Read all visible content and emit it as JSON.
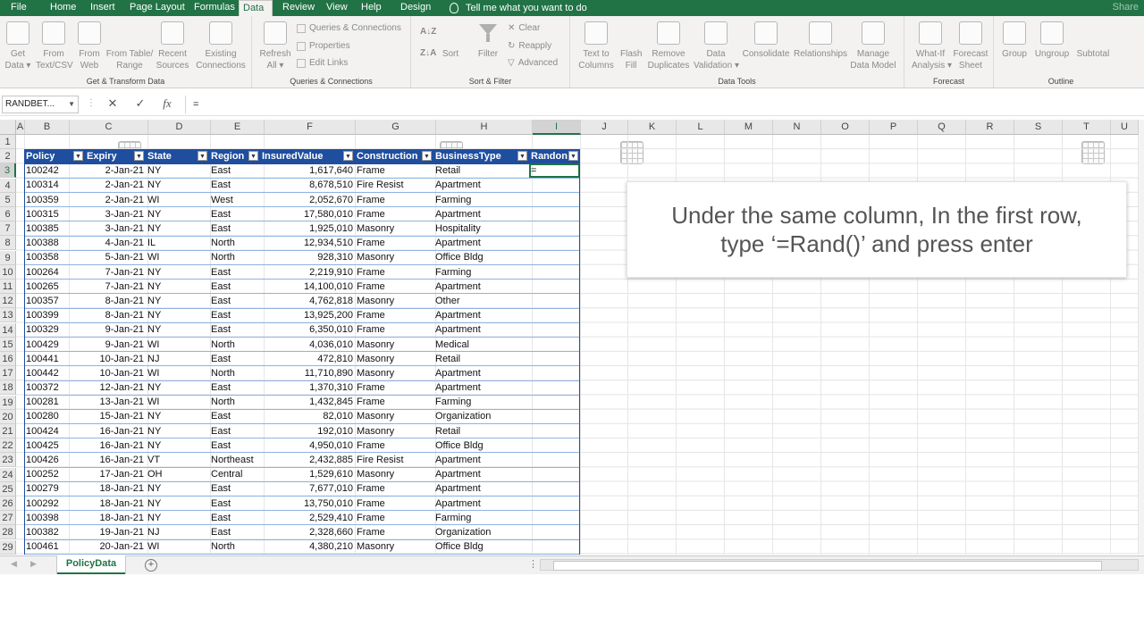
{
  "tabs": [
    "File",
    "Home",
    "Insert",
    "Page Layout",
    "Formulas",
    "Data",
    "Review",
    "View",
    "Help",
    "Design"
  ],
  "active_tab": "Data",
  "tell_me": "Tell me what you want to do",
  "share": "Share",
  "ribbon": {
    "get_transform": {
      "label": "Get & Transform Data",
      "buttons": [
        "Get\nData ▾",
        "From\nText/CSV",
        "From\nWeb",
        "From Table/\nRange",
        "Recent\nSources",
        "Existing\nConnections"
      ]
    },
    "queries": {
      "label": "Queries & Connections",
      "refresh": "Refresh\nAll ▾",
      "items": [
        "Queries & Connections",
        "Properties",
        "Edit Links"
      ]
    },
    "sort_filter": {
      "label": "Sort & Filter",
      "sort": "Sort",
      "filter": "Filter",
      "items": [
        "Clear",
        "Reapply",
        "Advanced"
      ]
    },
    "data_tools": {
      "label": "Data Tools",
      "buttons": [
        "Text to\nColumns",
        "Flash\nFill",
        "Remove\nDuplicates",
        "Data\nValidation ▾",
        "Consolidate",
        "Relationships",
        "Manage\nData Model"
      ]
    },
    "forecast": {
      "label": "Forecast",
      "buttons": [
        "What-If\nAnalysis ▾",
        "Forecast\nSheet"
      ]
    },
    "outline": {
      "label": "Outline",
      "buttons": [
        "Group",
        "Ungroup",
        "Subtotal"
      ]
    }
  },
  "formula_bar": {
    "name_box": "RANDBET...",
    "formula": "="
  },
  "columns": [
    "A",
    "B",
    "C",
    "D",
    "E",
    "F",
    "G",
    "H",
    "I",
    "J",
    "K",
    "L",
    "M",
    "N",
    "O",
    "P",
    "Q",
    "R",
    "S",
    "T",
    "U"
  ],
  "rows": [
    "1",
    "2",
    "3",
    "4",
    "5",
    "6",
    "7",
    "8",
    "9",
    "10",
    "11",
    "12",
    "13",
    "14",
    "15",
    "16",
    "17",
    "18",
    "19",
    "20",
    "21",
    "22",
    "23",
    "24",
    "25",
    "26",
    "27",
    "28",
    "29"
  ],
  "table": {
    "headers": [
      "Policy",
      "Expiry",
      "State",
      "Region",
      "InsuredValue",
      "Construction",
      "BusinessType",
      "Randon"
    ],
    "rows": [
      [
        "100242",
        "2-Jan-21",
        "NY",
        "East",
        "1,617,640",
        "Frame",
        "Retail",
        "="
      ],
      [
        "100314",
        "2-Jan-21",
        "NY",
        "East",
        "8,678,510",
        "Fire Resist",
        "Apartment",
        ""
      ],
      [
        "100359",
        "2-Jan-21",
        "WI",
        "West",
        "2,052,670",
        "Frame",
        "Farming",
        ""
      ],
      [
        "100315",
        "3-Jan-21",
        "NY",
        "East",
        "17,580,010",
        "Frame",
        "Apartment",
        ""
      ],
      [
        "100385",
        "3-Jan-21",
        "NY",
        "East",
        "1,925,010",
        "Masonry",
        "Hospitality",
        ""
      ],
      [
        "100388",
        "4-Jan-21",
        "IL",
        "North",
        "12,934,510",
        "Frame",
        "Apartment",
        ""
      ],
      [
        "100358",
        "5-Jan-21",
        "WI",
        "North",
        "928,310",
        "Masonry",
        "Office Bldg",
        ""
      ],
      [
        "100264",
        "7-Jan-21",
        "NY",
        "East",
        "2,219,910",
        "Frame",
        "Farming",
        ""
      ],
      [
        "100265",
        "7-Jan-21",
        "NY",
        "East",
        "14,100,010",
        "Frame",
        "Apartment",
        ""
      ],
      [
        "100357",
        "8-Jan-21",
        "NY",
        "East",
        "4,762,818",
        "Masonry",
        "Other",
        ""
      ],
      [
        "100399",
        "8-Jan-21",
        "NY",
        "East",
        "13,925,200",
        "Frame",
        "Apartment",
        ""
      ],
      [
        "100329",
        "9-Jan-21",
        "NY",
        "East",
        "6,350,010",
        "Frame",
        "Apartment",
        ""
      ],
      [
        "100429",
        "9-Jan-21",
        "WI",
        "North",
        "4,036,010",
        "Masonry",
        "Medical",
        ""
      ],
      [
        "100441",
        "10-Jan-21",
        "NJ",
        "East",
        "472,810",
        "Masonry",
        "Retail",
        ""
      ],
      [
        "100442",
        "10-Jan-21",
        "WI",
        "North",
        "11,710,890",
        "Masonry",
        "Apartment",
        ""
      ],
      [
        "100372",
        "12-Jan-21",
        "NY",
        "East",
        "1,370,310",
        "Frame",
        "Apartment",
        ""
      ],
      [
        "100281",
        "13-Jan-21",
        "WI",
        "North",
        "1,432,845",
        "Frame",
        "Farming",
        ""
      ],
      [
        "100280",
        "15-Jan-21",
        "NY",
        "East",
        "82,010",
        "Masonry",
        "Organization",
        ""
      ],
      [
        "100424",
        "16-Jan-21",
        "NY",
        "East",
        "192,010",
        "Masonry",
        "Retail",
        ""
      ],
      [
        "100425",
        "16-Jan-21",
        "NY",
        "East",
        "4,950,010",
        "Frame",
        "Office Bldg",
        ""
      ],
      [
        "100426",
        "16-Jan-21",
        "VT",
        "Northeast",
        "2,432,885",
        "Fire Resist",
        "Apartment",
        ""
      ],
      [
        "100252",
        "17-Jan-21",
        "OH",
        "Central",
        "1,529,610",
        "Masonry",
        "Apartment",
        ""
      ],
      [
        "100279",
        "18-Jan-21",
        "NY",
        "East",
        "7,677,010",
        "Frame",
        "Apartment",
        ""
      ],
      [
        "100292",
        "18-Jan-21",
        "NY",
        "East",
        "13,750,010",
        "Frame",
        "Apartment",
        ""
      ],
      [
        "100398",
        "18-Jan-21",
        "NY",
        "East",
        "2,529,410",
        "Frame",
        "Farming",
        ""
      ],
      [
        "100382",
        "19-Jan-21",
        "NJ",
        "East",
        "2,328,660",
        "Frame",
        "Organization",
        ""
      ],
      [
        "100461",
        "20-Jan-21",
        "WI",
        "North",
        "4,380,210",
        "Masonry",
        "Office Bldg",
        ""
      ]
    ]
  },
  "callout": {
    "line1": "Under the same column, In the first row,",
    "line2": "type ‘=Rand()’ and press enter"
  },
  "sheet_tab": "PolicyData",
  "add_sheet": "+",
  "colors": {
    "excel_green": "#217346",
    "table_header": "#1f4e9f"
  }
}
